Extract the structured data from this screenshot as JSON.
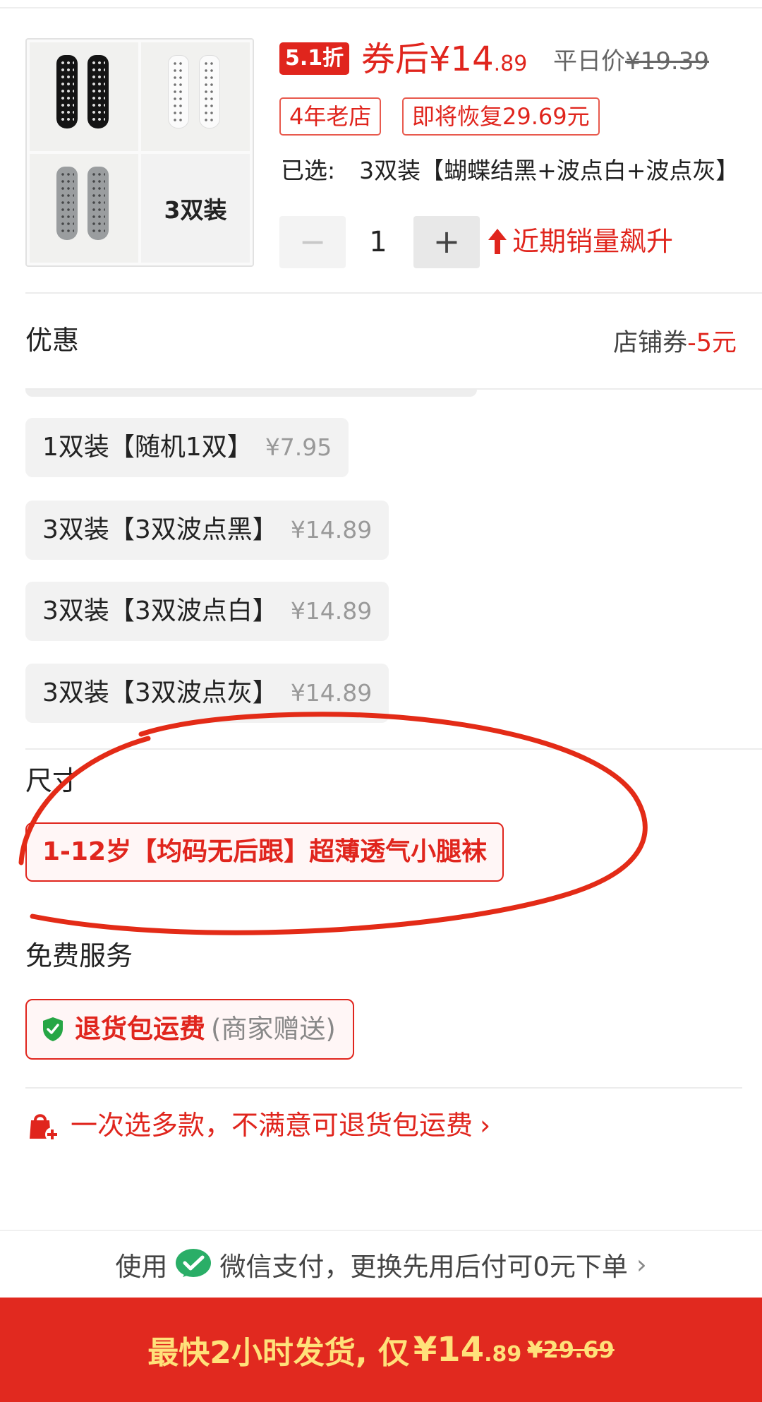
{
  "product": {
    "thumb_label": "3双装",
    "discount_badge": "5.1折",
    "price_after_prefix": "券后¥14",
    "price_after_cents": ".89",
    "normal_price_label": "平日价",
    "normal_price_value": "¥19.39",
    "tags": [
      "4年老店",
      "即将恢复29.69元"
    ],
    "selected_label": "已选:",
    "selected_value": "3双装【蝴蝶结黑+波点白+波点灰】",
    "quantity": "1",
    "minus": "−",
    "plus": "+",
    "trend_text": "近期销量飙升"
  },
  "coupon": {
    "title": "优惠",
    "shop_coupon": "店铺券",
    "shop_coupon_value": "-5元"
  },
  "options": [
    {
      "name": "1双装【随机1双】",
      "price": "¥7.95"
    },
    {
      "name": "3双装【3双波点黑】",
      "price": "¥14.89"
    },
    {
      "name": "3双装【3双波点白】",
      "price": "¥14.89"
    },
    {
      "name": "3双装【3双波点灰】",
      "price": "¥14.89"
    }
  ],
  "size": {
    "title": "尺寸",
    "option": "1-12岁【均码无后跟】超薄透气小腿袜"
  },
  "service": {
    "title": "免费服务",
    "name": "退货包运费",
    "note": "(商家赠送)"
  },
  "promo": {
    "text": "一次选多款，不满意可退货包运费",
    "chevron": "›"
  },
  "pay": {
    "prefix": "使用",
    "text": "微信支付，更换先用后付可0元下单",
    "chevron": "›"
  },
  "buy": {
    "text": "最快2小时发货, 仅",
    "price": "¥14",
    "price_cents": ".89",
    "orig_price": "¥29.69"
  },
  "colors": {
    "accent": "#e0251d",
    "buy_bar": "#e1291f",
    "buy_text": "#ffe17a",
    "wechat_green": "#2aae67"
  }
}
